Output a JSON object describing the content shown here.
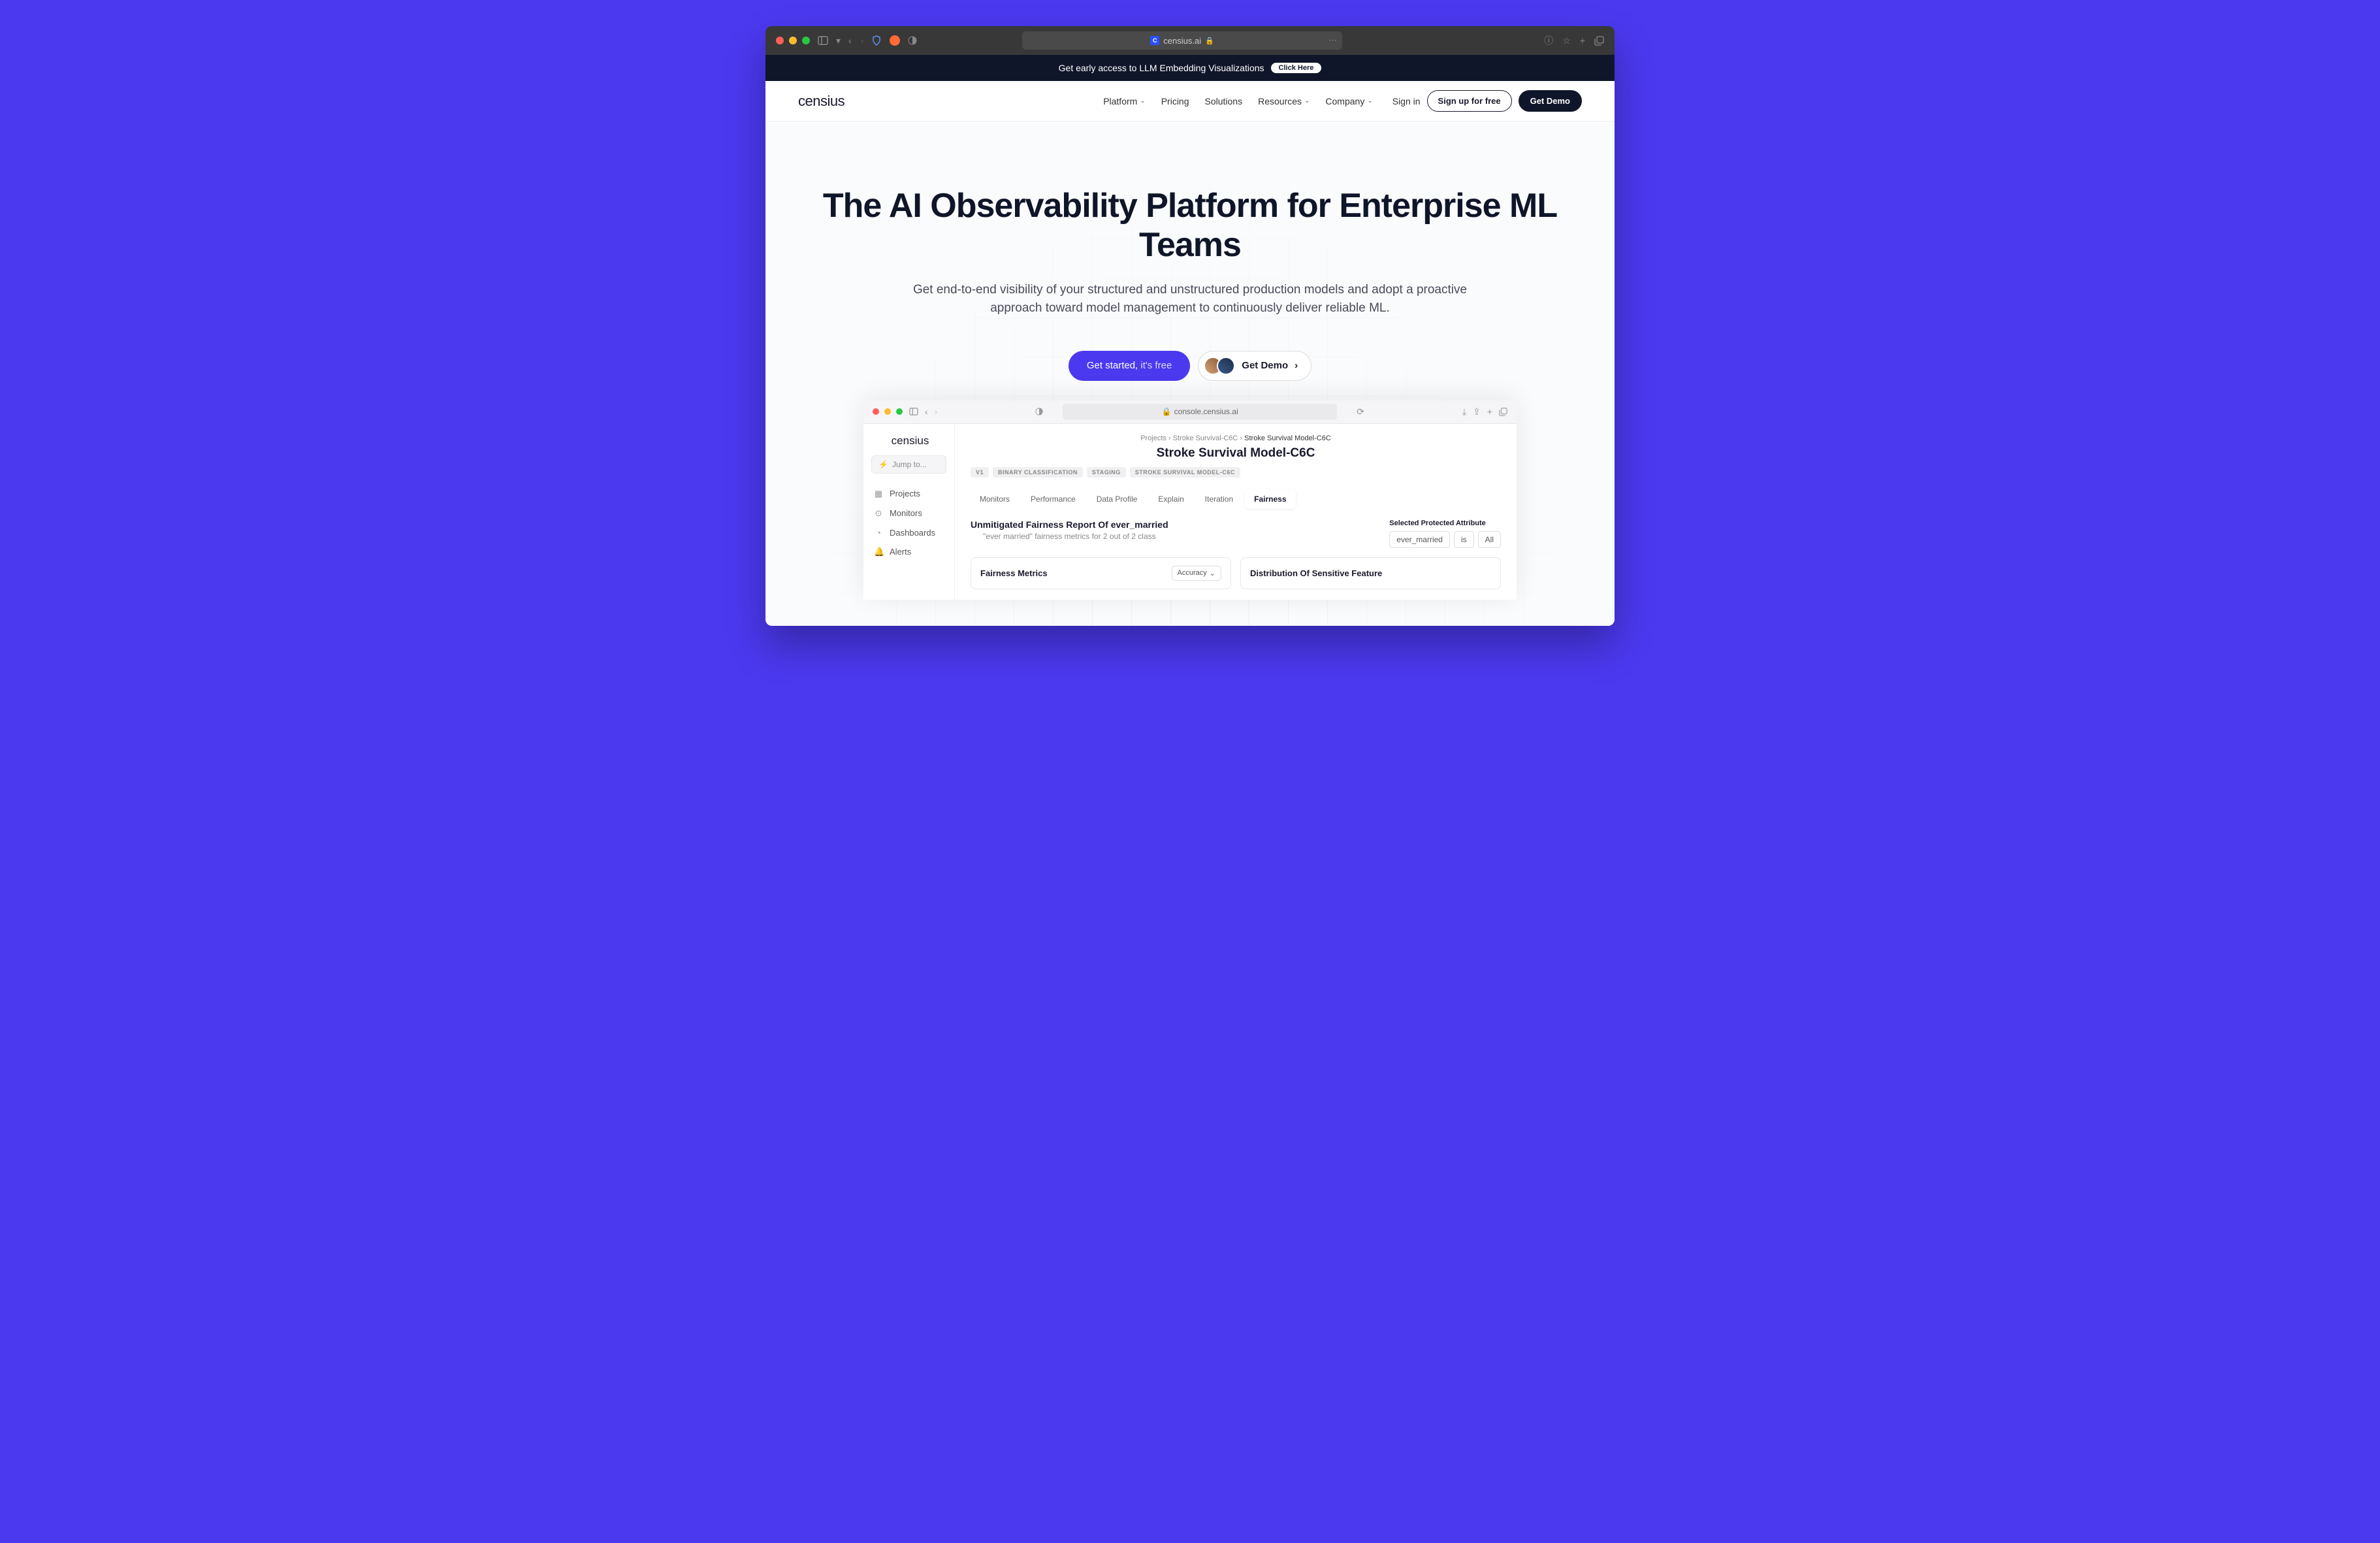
{
  "browser": {
    "url_host": "censius.ai"
  },
  "announcement": {
    "text": "Get early access to LLM Embedding Visualizations",
    "cta": "Click Here"
  },
  "nav": {
    "logo": "censius",
    "links": [
      "Platform",
      "Pricing",
      "Solutions",
      "Resources",
      "Company"
    ],
    "has_dropdown": [
      true,
      false,
      false,
      true,
      true
    ],
    "signin": "Sign in",
    "signup": "Sign up for free",
    "demo": "Get Demo"
  },
  "hero": {
    "title": "The AI Observability Platform for Enterprise ML Teams",
    "subtitle": "Get end-to-end visibility of your structured and unstructured production models and adopt a proactive approach toward model management to continuously deliver reliable ML.",
    "primary_cta_bold": "Get started,",
    "primary_cta_light": " it's free",
    "secondary_cta": "Get Demo"
  },
  "dashboard": {
    "url": "console.censius.ai",
    "logo": "censius",
    "jump_placeholder": "Jump to...",
    "sidebar": [
      {
        "icon": "▦",
        "label": "Projects"
      },
      {
        "icon": "⊙",
        "label": "Monitors"
      },
      {
        "icon": "◔",
        "label": "Dashboards"
      },
      {
        "icon": "🔔",
        "label": "Alerts"
      }
    ],
    "breadcrumb": [
      "Projects",
      "Stroke Survival-C6C",
      "Stroke Survival Model-C6C"
    ],
    "title": "Stroke Survival Model-C6C",
    "tags": [
      "V1",
      "BINARY CLASSIFICATION",
      "STAGING",
      "STROKE SURVIVAL MODEL-C6C"
    ],
    "tabs": [
      "Monitors",
      "Performance",
      "Data Profile",
      "Explain",
      "Iteration",
      "Fairness"
    ],
    "active_tab": "Fairness",
    "report_title": "Unmitigated Fairness Report Of ever_married",
    "report_sub": "\"ever married\" fairness metrics for 2 out of 2 class",
    "attr_label": "Selected Protected Attribute",
    "attr_chips": [
      "ever_married",
      "is",
      "All"
    ],
    "card1_title": "Fairness Metrics",
    "card1_chip": "Accuracy",
    "card2_title": "Distribution Of Sensitive Feature"
  }
}
